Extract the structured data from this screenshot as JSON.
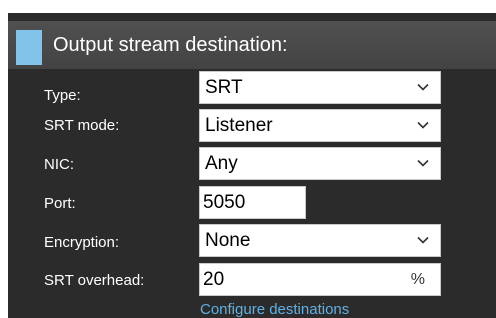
{
  "section": {
    "title": "Output stream destination:"
  },
  "accent_color": "#82c3ea",
  "form": {
    "type_label": "Type:",
    "type_value": "SRT",
    "srt_mode_label": "SRT mode:",
    "srt_mode_value": "Listener",
    "nic_label": "NIC:",
    "nic_value": "Any",
    "port_label": "Port:",
    "port_value": "5050",
    "encryption_label": "Encryption:",
    "encryption_value": "None",
    "overhead_label": "SRT overhead:",
    "overhead_value": "20",
    "overhead_unit": "%"
  },
  "links": {
    "configure": "Configure destinations"
  },
  "icons": {
    "dropdown": "chevron-down-icon"
  }
}
